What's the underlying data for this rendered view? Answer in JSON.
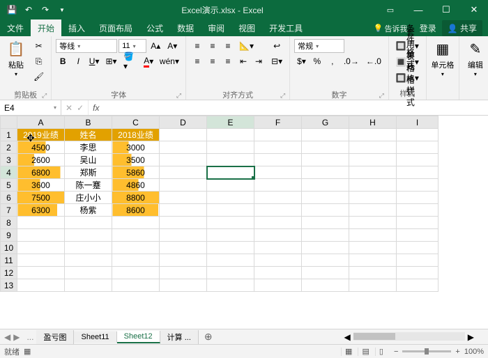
{
  "window": {
    "title": "Excel演示.xlsx - Excel"
  },
  "tabs": {
    "file": "文件",
    "home": "开始",
    "insert": "插入",
    "layout": "页面布局",
    "formulas": "公式",
    "data": "数据",
    "review": "审阅",
    "view": "视图",
    "dev": "开发工具",
    "tell": "告诉我...",
    "login": "登录",
    "share": "共享"
  },
  "ribbon": {
    "clipboard": {
      "label": "剪贴板",
      "paste": "粘贴"
    },
    "font": {
      "label": "字体",
      "name": "等线",
      "size": "11",
      "wen": "wén"
    },
    "alignment": {
      "label": "对齐方式"
    },
    "number": {
      "label": "数字",
      "format": "常规"
    },
    "styles": {
      "label": "样式",
      "cond": "条件格式",
      "table": "套用表格格式",
      "cell": "单元格样式"
    },
    "cells": {
      "label": "单元格"
    },
    "editing": {
      "label": "编辑"
    }
  },
  "namebox": {
    "ref": "E4",
    "fx": "fx"
  },
  "chart_data": {
    "type": "table",
    "columns": [
      "",
      "A",
      "B",
      "C",
      "D",
      "E",
      "F",
      "G",
      "H",
      "I"
    ],
    "headers": {
      "A": "2019业绩",
      "B": "姓名",
      "C": "2018业绩"
    },
    "rows": [
      {
        "a": 4500,
        "b": "李思",
        "c": 3000
      },
      {
        "a": 2600,
        "b": "吴山",
        "c": 3500
      },
      {
        "a": 6800,
        "b": "郑斯",
        "c": 5860
      },
      {
        "a": 3600,
        "b": "陈一蹇",
        "c": 4860
      },
      {
        "a": 7500,
        "b": "庄小小",
        "c": 8800
      },
      {
        "a": 6300,
        "b": "杨紫",
        "c": 8600
      }
    ],
    "a_max": 7500,
    "c_max": 8800,
    "row_count": 13
  },
  "sheets": {
    "nav_more": "...",
    "s1": "盈亏图",
    "s2": "Sheet11",
    "s3": "Sheet12",
    "s4": "计算",
    "add": "⊕"
  },
  "status": {
    "ready": "就绪",
    "zoom": "100%"
  },
  "colors": {
    "accent": "#1a7047",
    "header_fill": "#e2a100",
    "bar_fill": "#ffbe2e"
  }
}
